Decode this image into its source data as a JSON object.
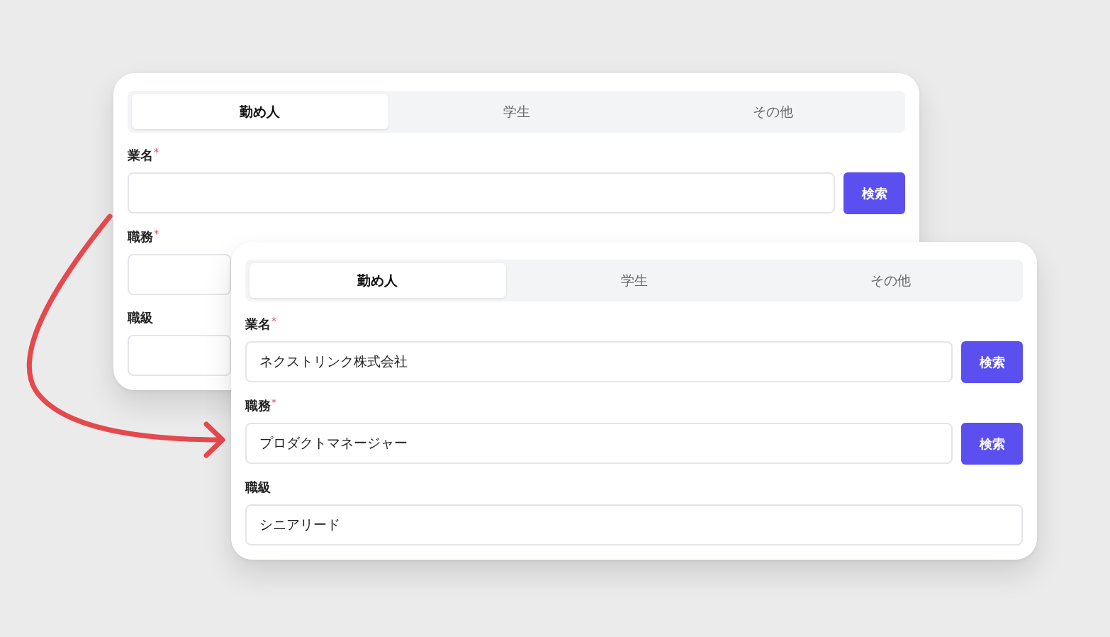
{
  "cards": [
    {
      "tabs": [
        {
          "label": "勤め人",
          "selected": true
        },
        {
          "label": "学生",
          "selected": false
        },
        {
          "label": "その他",
          "selected": false
        }
      ],
      "fields": [
        {
          "label": "業名",
          "required_mark": "*",
          "search_button": "検索"
        },
        {
          "label": "職務",
          "required_mark": "*"
        },
        {
          "label": "職級"
        }
      ]
    },
    {
      "tabs": [
        {
          "label": "勤め人",
          "selected": true
        },
        {
          "label": "学生",
          "selected": false
        },
        {
          "label": "その他",
          "selected": false
        }
      ],
      "fields": [
        {
          "label": "業名",
          "required_mark": "*",
          "value": "ネクストリンク株式会社",
          "search_button": "検索"
        },
        {
          "label": "職務",
          "required_mark": "*",
          "value": "プロダクトマネージャー",
          "search_button": "検索"
        },
        {
          "label": "職級",
          "value": "シニアリード"
        }
      ]
    }
  ]
}
